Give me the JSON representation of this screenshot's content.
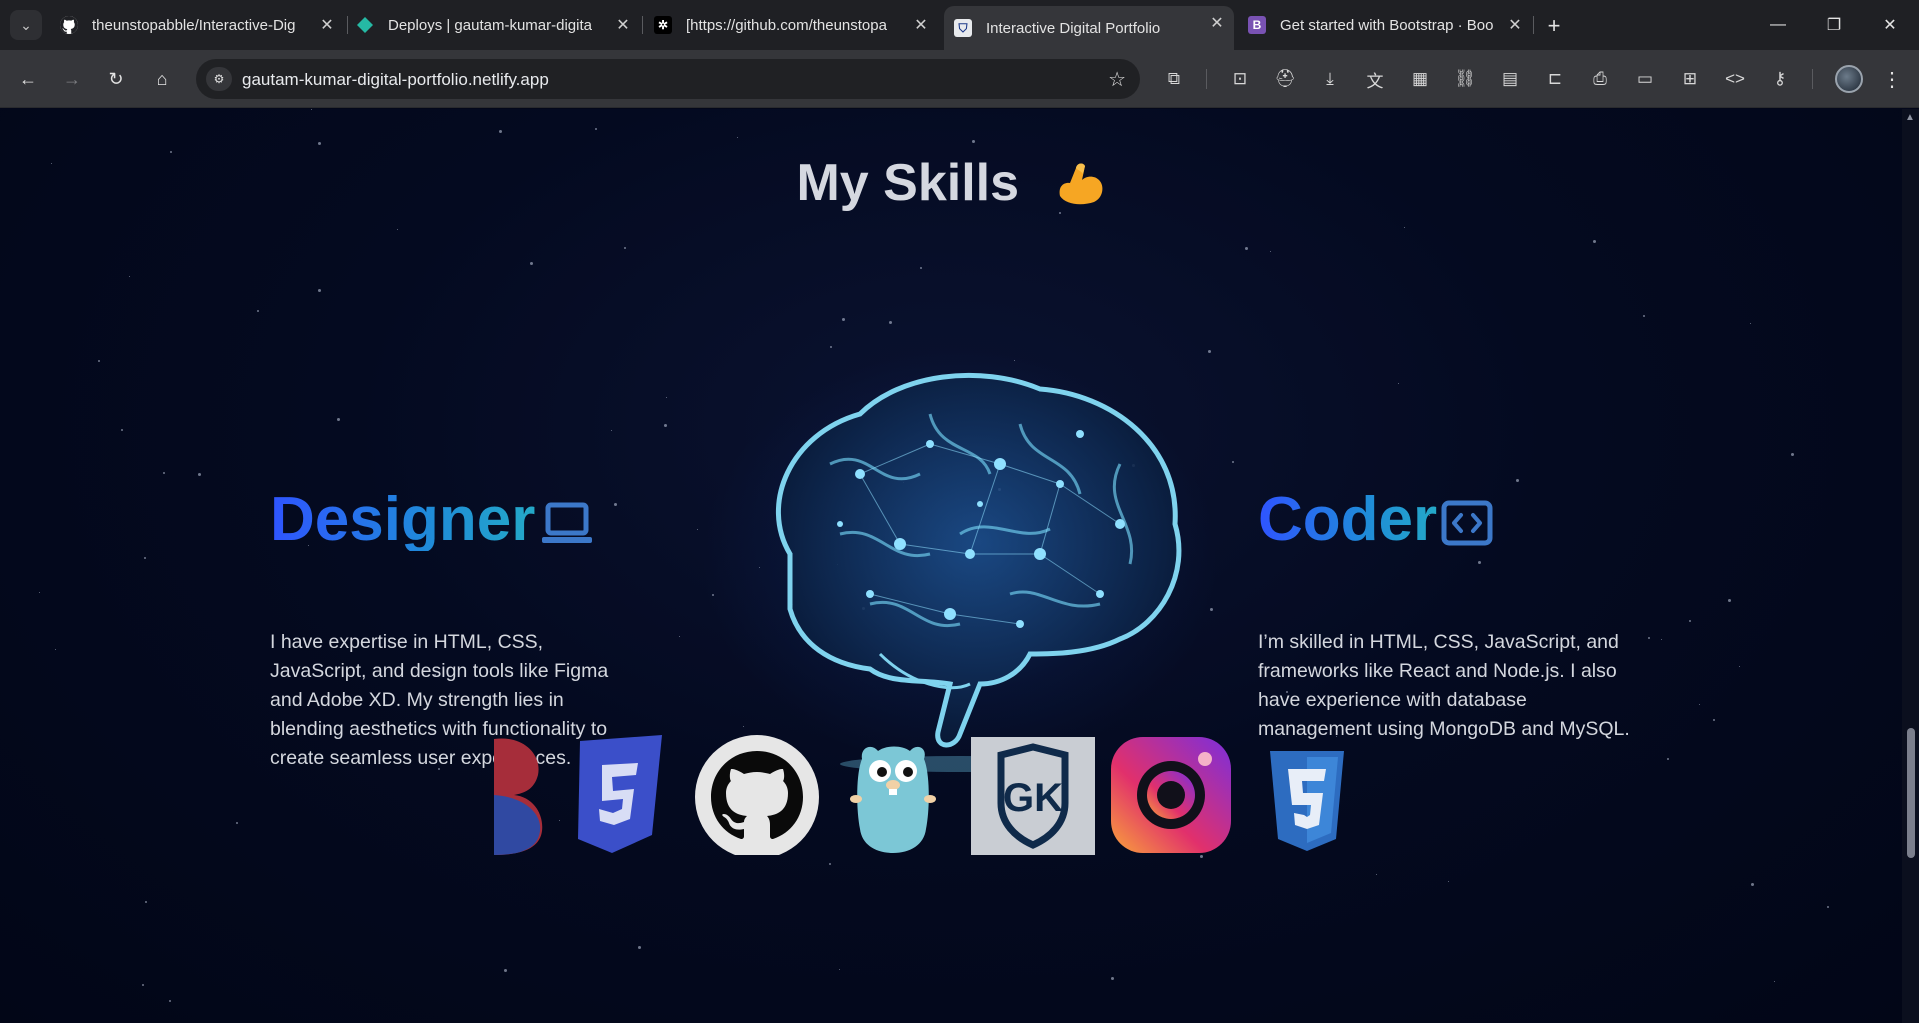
{
  "browser": {
    "tabs": [
      {
        "title": "theunstopabble/Interactive-Dig",
        "favicon": "github-icon"
      },
      {
        "title": "Deploys | gautam-kumar-digita",
        "favicon": "netlify-icon"
      },
      {
        "title": "[https://github.com/theunstopa",
        "favicon": "app-icon"
      },
      {
        "title": "Interactive Digital Portfolio",
        "favicon": "portfolio-icon",
        "active": true
      },
      {
        "title": "Get started with Bootstrap · Boo",
        "favicon": "bootstrap-icon"
      }
    ],
    "address": "gautam-kumar-digital-portfolio.netlify.app"
  },
  "page": {
    "section_title": "My Skills",
    "section_emoji": "flexed-biceps-emoji",
    "designer": {
      "title": "Designer",
      "icon": "laptop-icon",
      "text": "I have expertise in HTML, CSS, JavaScript, and design tools like Figma and Adobe XD. My strength lies in blending aesthetics with functionality to create seamless user experiences."
    },
    "coder": {
      "title": "Coder",
      "icon": "code-icon",
      "text": "I’m skilled in HTML, CSS, JavaScript, and frameworks like React and Node.js. I also have experience with database management using MongoDB and MySQL."
    },
    "logos": [
      "bootstrap-logo-partial",
      "css3-logo",
      "github-logo",
      "go-gopher-logo",
      "gk-logo",
      "instagram-logo",
      "css3-logo"
    ],
    "logo_gk_text": "GK"
  },
  "colors": {
    "background": "#03071a",
    "accent_gradient_start": "#2f54ff",
    "accent_gradient_end": "#24a9c8",
    "body_text": "#d4d7de"
  }
}
